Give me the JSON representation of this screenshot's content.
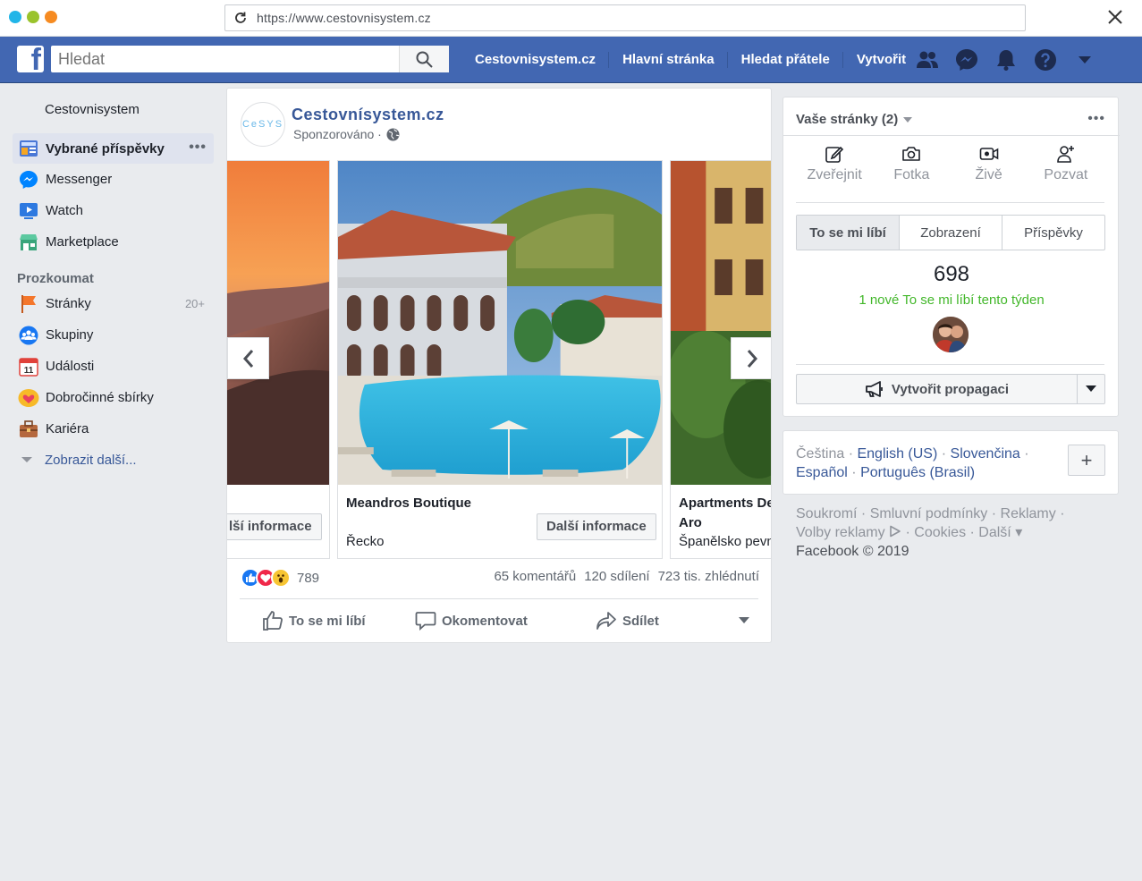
{
  "browser": {
    "url": "https://www.cestovnisystem.cz",
    "dot_colors": [
      "#21b5e8",
      "#9ac32c",
      "#f68b21"
    ]
  },
  "topbar": {
    "logo_letter": "f",
    "search_placeholder": "Hledat",
    "links": [
      "Cestovnisystem.cz",
      "Hlavní stránka",
      "Hledat přátele",
      "Vytvořit"
    ],
    "icons": [
      "friends-icon",
      "messenger-icon",
      "notifications-icon",
      "help-icon",
      "account-menu-icon"
    ],
    "brand_color": "#4267b2"
  },
  "sidebar": {
    "user": "Cestovnisystem",
    "items": [
      {
        "label": "Vybrané příspěvky",
        "icon": "news-feed-icon",
        "active": true,
        "more": "•••"
      },
      {
        "label": "Messenger",
        "icon": "messenger-icon"
      },
      {
        "label": "Watch",
        "icon": "watch-icon"
      },
      {
        "label": "Marketplace",
        "icon": "marketplace-icon"
      }
    ],
    "explore_heading": "Prozkoumat",
    "explore": [
      {
        "label": "Stránky",
        "icon": "pages-flag-icon",
        "count": "20+"
      },
      {
        "label": "Skupiny",
        "icon": "groups-icon"
      },
      {
        "label": "Události",
        "icon": "calendar-icon",
        "badge": "11"
      },
      {
        "label": "Dobročinné sbírky",
        "icon": "fundraiser-heart-icon"
      },
      {
        "label": "Kariéra",
        "icon": "briefcase-icon"
      }
    ],
    "show_more": "Zobrazit další..."
  },
  "post": {
    "page_logo_text": "CeSYS",
    "page_name": "Cestovnísystem.cz",
    "meta": "Sponzorováno ·",
    "cards": [
      {
        "title": "",
        "subtitle": "",
        "cta": "lší informace"
      },
      {
        "title": "Meandros Boutique",
        "subtitle": "Řecko",
        "cta": "Další informace"
      },
      {
        "title": "Apartments De Aro",
        "subtitle": "Španělsko pevn",
        "cta": ""
      }
    ],
    "reaction_count": "789",
    "comments": "65 komentářů",
    "shares": "120 sdílení",
    "views": "723 tis. zhlédnutí",
    "actions": {
      "like": "To se mi líbí",
      "comment": "Okomentovat",
      "share": "Sdílet"
    }
  },
  "right_panel": {
    "title": "Vaše stránky (2)",
    "more": "•••",
    "actions": [
      "Zveřejnit",
      "Fotka",
      "Živě",
      "Pozvat"
    ],
    "tabs": [
      "To se mi líbí",
      "Zobrazení",
      "Příspěvky"
    ],
    "likes": "698",
    "new_likes": "1 nové To se mi líbí tento týden",
    "promote": "Vytvořit propagaci"
  },
  "languages": {
    "current": "Čeština",
    "sep": "·",
    "links": [
      "English (US)",
      "Slovenčina",
      "Español",
      "Português (Brasil)"
    ],
    "add": "+"
  },
  "footer": {
    "line1": "Soukromí · Smluvní podmínky · Reklamy ·",
    "line2a": "Volby reklamy",
    "line2b": " · Cookies · Další ▾",
    "copyright": "Facebook © 2019"
  }
}
